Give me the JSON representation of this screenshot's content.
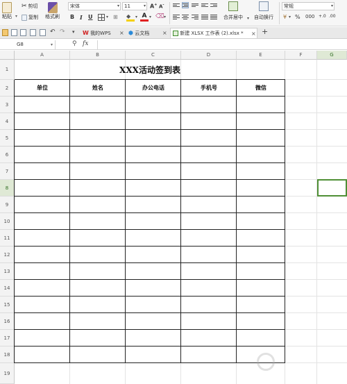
{
  "ribbon": {
    "paste_label": "粘贴",
    "cut_label": "剪切",
    "copy_label": "复制",
    "format_painter_label": "格式刷",
    "font_name": "宋体",
    "font_size": "11",
    "merge_center_label": "合并居中",
    "wrap_text_label": "自动换行",
    "number_format": "常规"
  },
  "tabs": [
    {
      "label": "我的WPS"
    },
    {
      "label": "云文档"
    },
    {
      "label": "新建 XLSX 工作表 (2).xlsx *"
    }
  ],
  "formula_bar": {
    "name_box": "G8",
    "fx_label": "fx"
  },
  "columns": [
    "A",
    "B",
    "C",
    "D",
    "E",
    "F",
    "G"
  ],
  "rows": [
    "1",
    "2",
    "3",
    "4",
    "5",
    "6",
    "7",
    "8",
    "9",
    "10",
    "11",
    "12",
    "13",
    "14",
    "15",
    "16",
    "17",
    "18",
    "19"
  ],
  "sheet": {
    "title": "XXX活动签到表",
    "headers": [
      "单位",
      "姓名",
      "办公电话",
      "手机号",
      "微信"
    ]
  },
  "watermark_text": "Baidu经验"
}
